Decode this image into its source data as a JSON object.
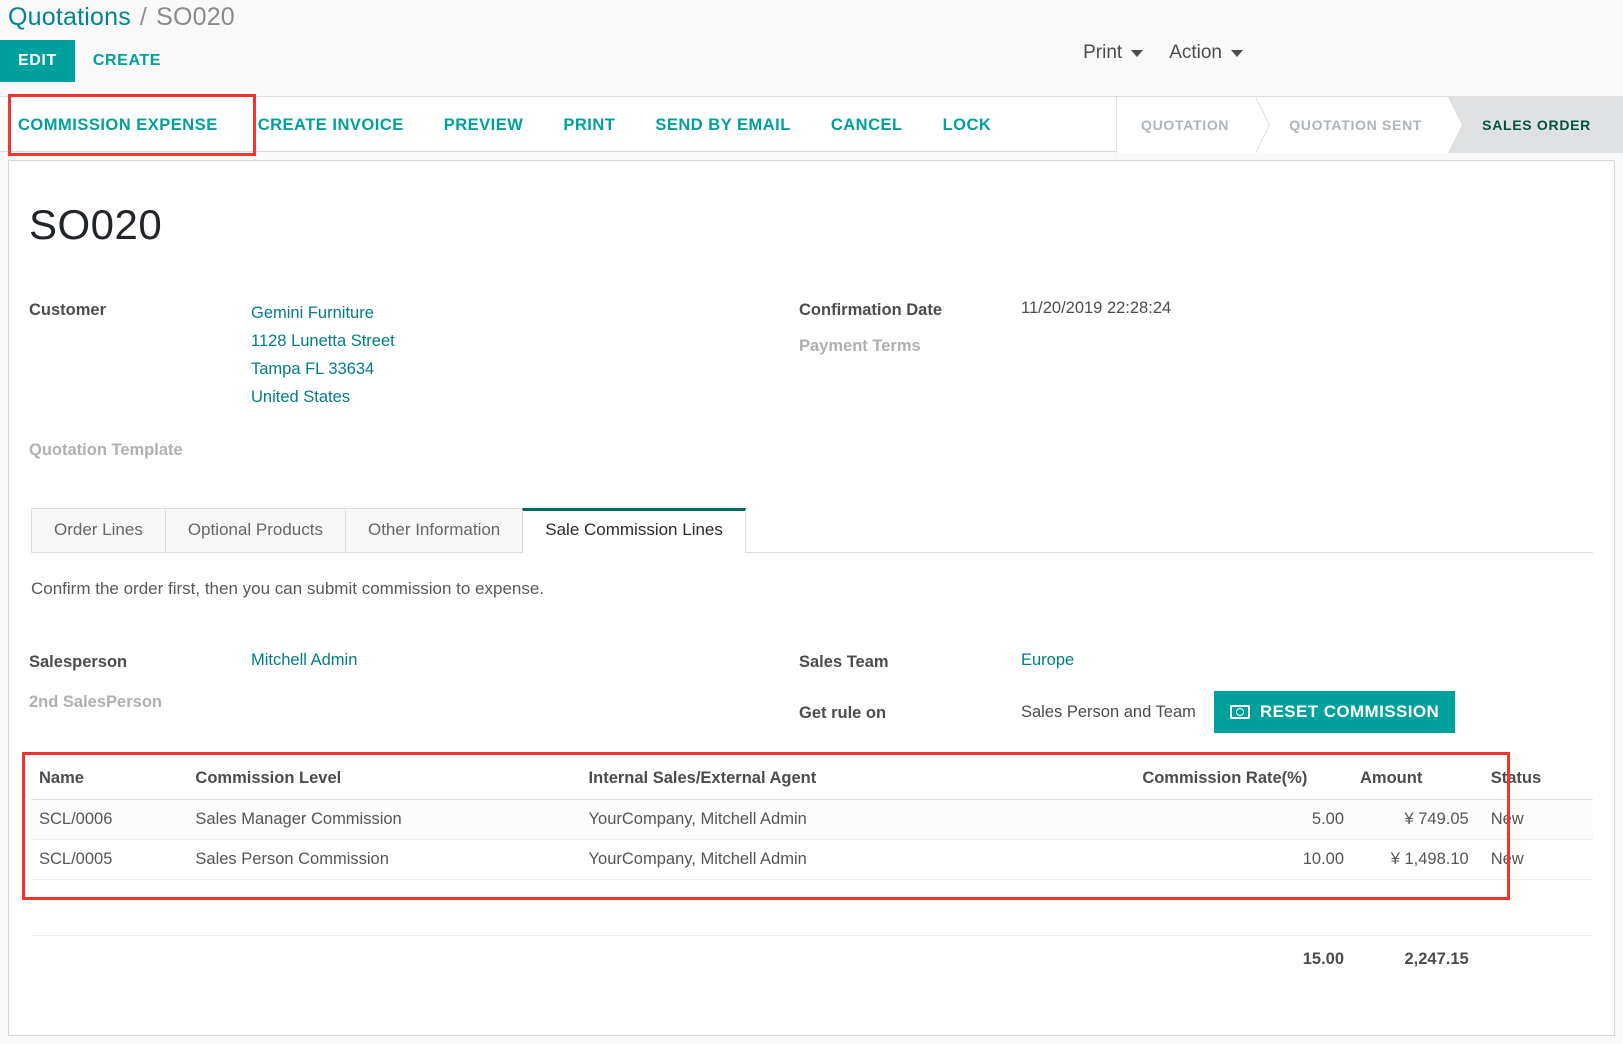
{
  "breadcrumb": {
    "root": "Quotations",
    "separator": "/",
    "current": "SO020"
  },
  "toolbar": {
    "edit_label": "EDIT",
    "create_label": "CREATE"
  },
  "menus": {
    "print_label": "Print",
    "action_label": "Action"
  },
  "status_actions": [
    {
      "label": "COMMISSION EXPENSE",
      "name": "commission-expense"
    },
    {
      "label": "CREATE INVOICE",
      "name": "create-invoice"
    },
    {
      "label": "PREVIEW",
      "name": "preview"
    },
    {
      "label": "PRINT",
      "name": "print"
    },
    {
      "label": "SEND BY EMAIL",
      "name": "send-by-email"
    },
    {
      "label": "CANCEL",
      "name": "cancel"
    },
    {
      "label": "LOCK",
      "name": "lock"
    }
  ],
  "pipeline": [
    {
      "label": "QUOTATION",
      "active": false
    },
    {
      "label": "QUOTATION SENT",
      "active": false
    },
    {
      "label": "SALES ORDER",
      "active": true
    }
  ],
  "record": {
    "title": "SO020",
    "customer_label": "Customer",
    "customer_name": "Gemini Furniture",
    "customer_address_1": "1128 Lunetta Street",
    "customer_address_2": "Tampa FL 33634",
    "customer_country": "United States",
    "quotation_template_label": "Quotation Template",
    "quotation_template_value": "",
    "confirmation_date_label": "Confirmation Date",
    "confirmation_date_value": "11/20/2019 22:28:24",
    "payment_terms_label": "Payment Terms",
    "payment_terms_value": ""
  },
  "tabs": [
    {
      "label": "Order Lines",
      "active": false
    },
    {
      "label": "Optional Products",
      "active": false
    },
    {
      "label": "Other Information",
      "active": false
    },
    {
      "label": "Sale Commission Lines",
      "active": true
    }
  ],
  "commission_tab": {
    "hint": "Confirm the order first, then you can submit commission to expense.",
    "salesperson_label": "Salesperson",
    "salesperson_value": "Mitchell Admin",
    "second_salesperson_label": "2nd SalesPerson",
    "second_salesperson_value": "",
    "sales_team_label": "Sales Team",
    "sales_team_value": "Europe",
    "get_rule_on_label": "Get rule on",
    "get_rule_on_value": "Sales Person and Team",
    "reset_button_label": "RESET COMMISSION"
  },
  "commission_table": {
    "columns": [
      "Name",
      "Commission Level",
      "Internal Sales/External Agent",
      "Commission Rate(%)",
      "Amount",
      "Status"
    ],
    "rows": [
      {
        "name": "SCL/0006",
        "level": "Sales Manager Commission",
        "agent": "YourCompany, Mitchell Admin",
        "rate": "5.00",
        "amount": "¥ 749.05",
        "status": "New"
      },
      {
        "name": "SCL/0005",
        "level": "Sales Person Commission",
        "agent": "YourCompany, Mitchell Admin",
        "rate": "10.00",
        "amount": "¥ 1,498.10",
        "status": "New"
      }
    ],
    "totals": {
      "rate": "15.00",
      "amount": "2,247.15"
    }
  },
  "colors": {
    "accent": "#00a09d",
    "link": "#017e84",
    "pipeline_active_text": "#00553f",
    "annotation": "#f4342f"
  }
}
